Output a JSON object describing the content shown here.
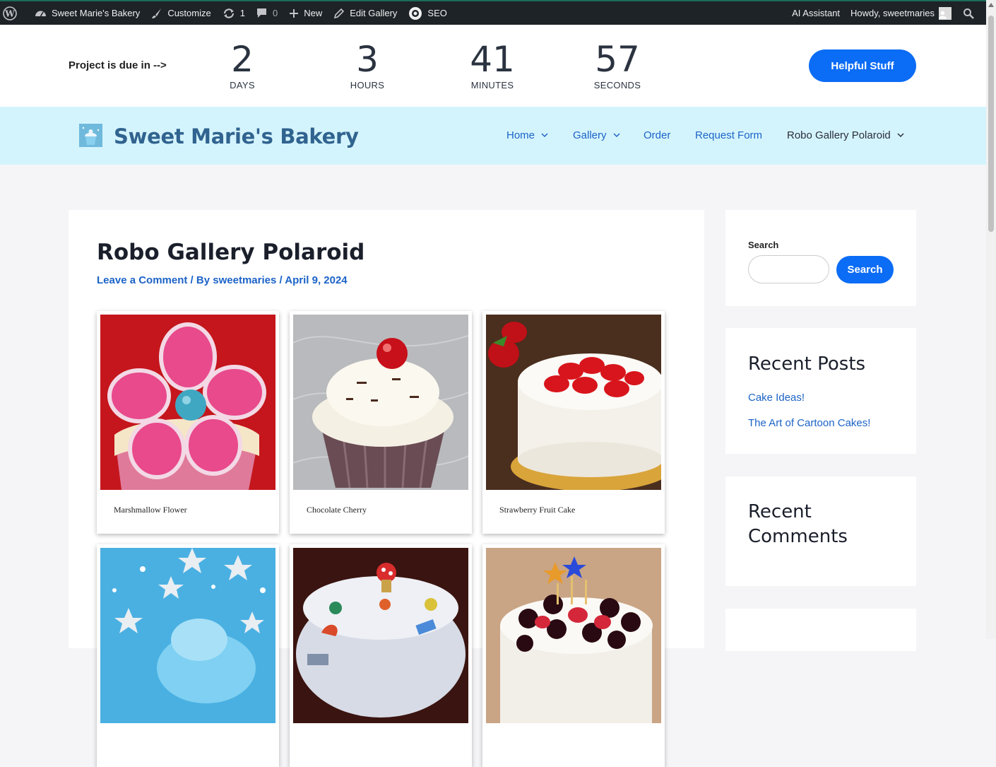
{
  "admin_bar": {
    "site_name": "Sweet Marie's Bakery",
    "customize": "Customize",
    "updates_count": "1",
    "comments_count": "0",
    "new": "New",
    "edit_gallery": "Edit Gallery",
    "seo": "SEO",
    "ai_assistant": "AI Assistant",
    "howdy": "Howdy, sweetmaries"
  },
  "countdown": {
    "label": "Project is due in -->",
    "days": "2",
    "days_label": "DAYS",
    "hours": "3",
    "hours_label": "HOURS",
    "minutes": "41",
    "minutes_label": "MINUTES",
    "seconds": "57",
    "seconds_label": "SECONDS",
    "button": "Helpful Stuff"
  },
  "header": {
    "site_title": "Sweet Marie's Bakery",
    "nav": {
      "home": "Home",
      "gallery": "Gallery",
      "order": "Order",
      "request_form": "Request Form",
      "robo": "Robo Gallery Polaroid"
    }
  },
  "post": {
    "title": "Robo Gallery Polaroid",
    "meta_comment": "Leave a Comment",
    "meta_by": " / By ",
    "meta_author": "sweetmaries",
    "meta_sep": " / ",
    "meta_date": "April 9, 2024",
    "gallery": [
      {
        "caption": "Marshmallow Flower"
      },
      {
        "caption": "Chocolate Cherry"
      },
      {
        "caption": "Strawberry Fruit Cake"
      }
    ]
  },
  "sidebar": {
    "search_label": "Search",
    "search_button": "Search",
    "recent_posts_title": "Recent Posts",
    "recent_posts": [
      "Cake Ideas!",
      "The Art of Cartoon Cakes!"
    ],
    "recent_comments_line1": "Recent",
    "recent_comments_line2": "Comments"
  },
  "colors": {
    "accent": "#0b6cf5",
    "link": "#1c63c7",
    "header_bg": "#d4f4fd",
    "admin_bar_bg": "#1d2327"
  }
}
